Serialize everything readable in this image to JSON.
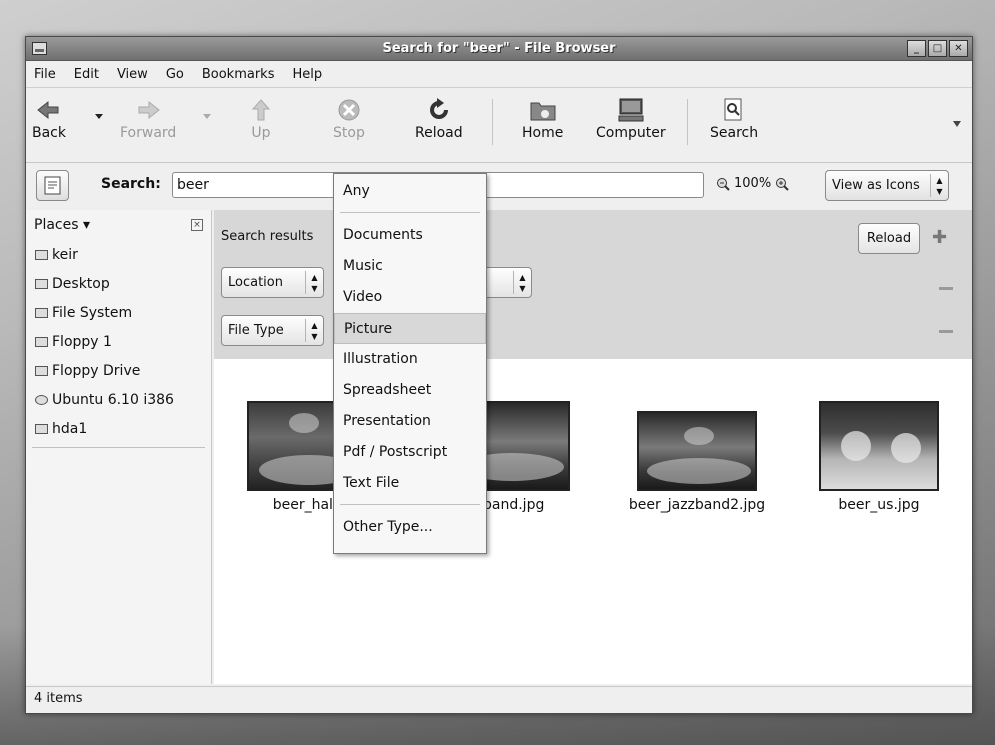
{
  "window": {
    "title": "Search for \"beer\" - File Browser"
  },
  "menubar": [
    {
      "label": "File"
    },
    {
      "label": "Edit"
    },
    {
      "label": "View"
    },
    {
      "label": "Go"
    },
    {
      "label": "Bookmarks"
    },
    {
      "label": "Help"
    }
  ],
  "toolbar": {
    "back": "Back",
    "forward": "Forward",
    "up": "Up",
    "stop": "Stop",
    "reload": "Reload",
    "home": "Home",
    "computer": "Computer",
    "search": "Search"
  },
  "location_bar": {
    "search_label": "Search:",
    "search_value": "beer",
    "zoom": "100%",
    "view_as": "View as Icons"
  },
  "sidebar": {
    "header": "Places",
    "items": [
      {
        "label": "keir",
        "icon": "home-folder-icon"
      },
      {
        "label": "Desktop",
        "icon": "desktop-icon"
      },
      {
        "label": "File System",
        "icon": "drive-icon"
      },
      {
        "label": "Floppy 1",
        "icon": "floppy-icon"
      },
      {
        "label": "Floppy Drive",
        "icon": "floppy-icon"
      },
      {
        "label": "Ubuntu 6.10 i386",
        "icon": "cdrom-icon"
      },
      {
        "label": "hda1",
        "icon": "drive-icon"
      }
    ]
  },
  "search_criteria": {
    "label": "Search results",
    "row1_type": "Location",
    "row2_type": "File Type",
    "reload": "Reload"
  },
  "files": [
    {
      "name": "beer_hall.jpg",
      "shown_name": "beer_hall."
    },
    {
      "name": "beer_jazzband.jpg",
      "shown_name": "zband.jpg"
    },
    {
      "name": "beer_jazzband2.jpg",
      "shown_name": "beer_jazzband2.jpg"
    },
    {
      "name": "beer_us.jpg",
      "shown_name": "beer_us.jpg"
    }
  ],
  "file_type_menu": {
    "items": [
      {
        "label": "Any"
      },
      {
        "label": "Documents"
      },
      {
        "label": "Music"
      },
      {
        "label": "Video"
      },
      {
        "label": "Picture",
        "selected": true
      },
      {
        "label": "Illustration"
      },
      {
        "label": "Spreadsheet"
      },
      {
        "label": "Presentation"
      },
      {
        "label": "Pdf / Postscript"
      },
      {
        "label": "Text File"
      },
      {
        "label": "Other Type..."
      }
    ]
  },
  "statusbar": {
    "text": "4 items"
  }
}
